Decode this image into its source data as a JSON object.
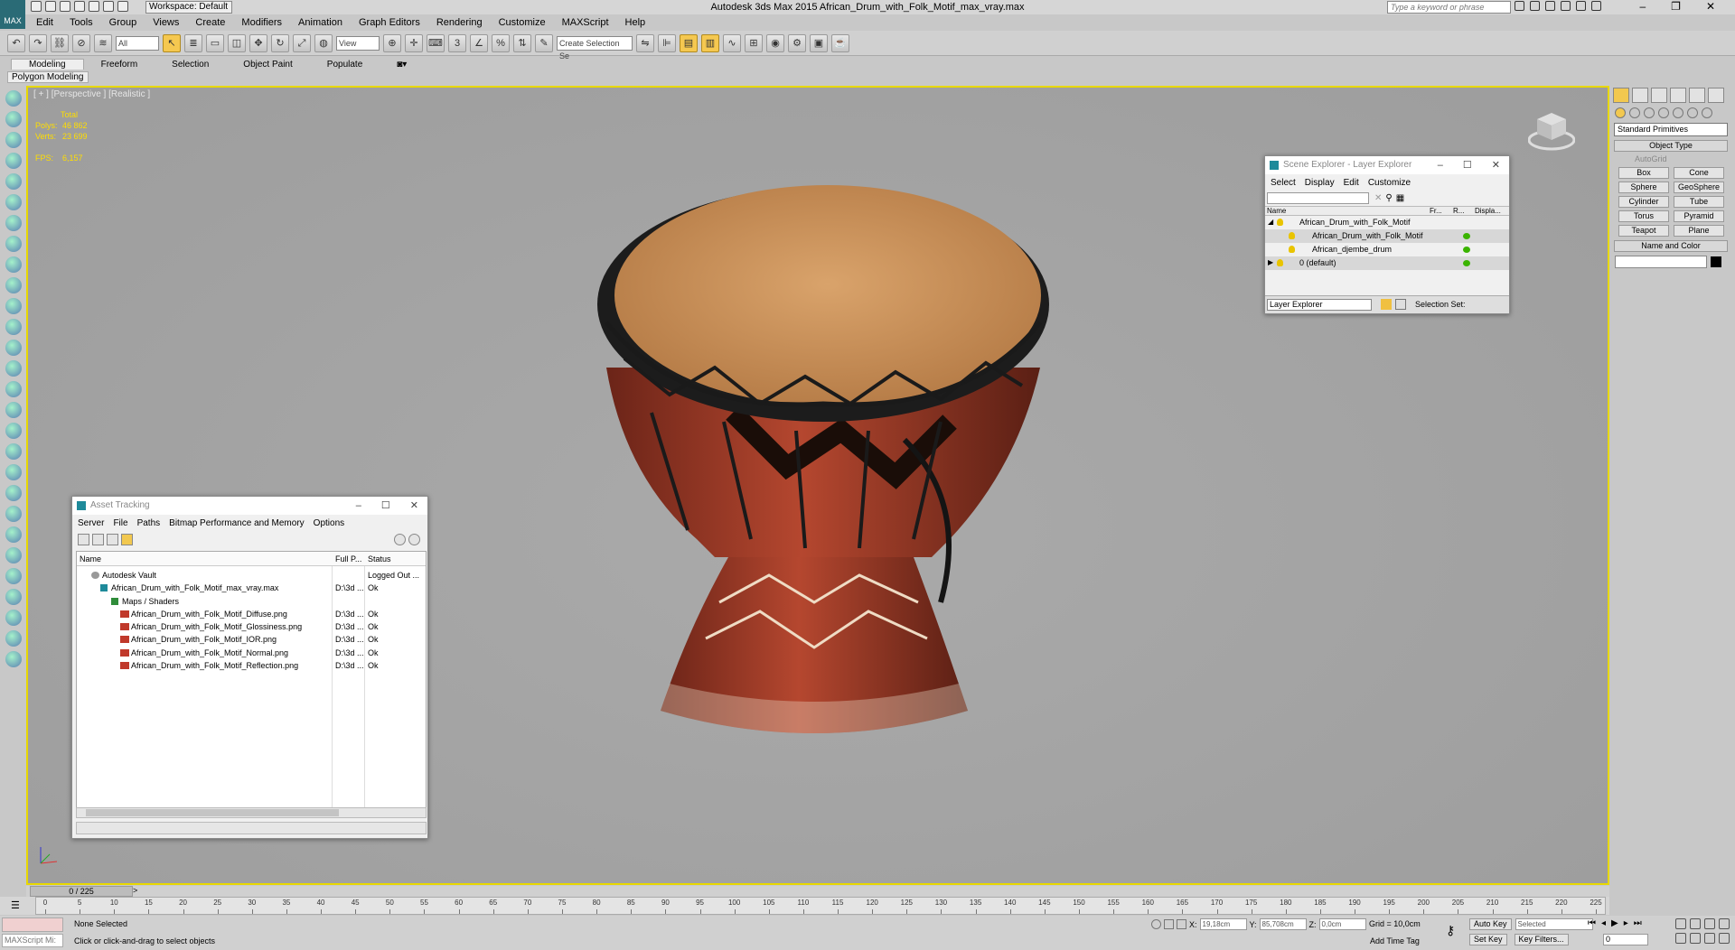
{
  "window": {
    "title": "Autodesk 3ds Max  2015     African_Drum_with_Folk_Motif_max_vray.max",
    "app_badge": "MAX"
  },
  "workspace": "Workspace: Default",
  "search_placeholder": "Type a keyword or phrase",
  "menu": [
    "Edit",
    "Tools",
    "Group",
    "Views",
    "Create",
    "Modifiers",
    "Animation",
    "Graph Editors",
    "Rendering",
    "Customize",
    "MAXScript",
    "Help"
  ],
  "toolbar": {
    "selection_filter": "All",
    "ref_coord": "View",
    "named_sel": "Create Selection Se"
  },
  "ribbon": {
    "tabs": [
      "Modeling",
      "Freeform",
      "Selection",
      "Object Paint",
      "Populate"
    ],
    "panel": "Polygon Modeling"
  },
  "viewport": {
    "label": "[ + ] [Perspective ] [Realistic ]",
    "stats": {
      "total": "Total",
      "polys_label": "Polys:",
      "polys": "46 862",
      "verts_label": "Verts:",
      "verts": "23 699",
      "fps_label": "FPS:",
      "fps": "6,157"
    }
  },
  "command_panel": {
    "dropdown": "Standard Primitives",
    "object_type": "Object Type",
    "autogrid": "AutoGrid",
    "buttons": [
      "Box",
      "Cone",
      "Sphere",
      "GeoSphere",
      "Cylinder",
      "Tube",
      "Torus",
      "Pyramid",
      "Teapot",
      "Plane"
    ],
    "name_and_color": "Name and Color",
    "object_color": "#000000"
  },
  "scene_explorer": {
    "title": "Scene Explorer - Layer Explorer",
    "menu": [
      "Select",
      "Display",
      "Edit",
      "Customize"
    ],
    "columns": [
      "Name",
      "Fr...",
      "R...",
      "Displa..."
    ],
    "rows": [
      {
        "name": "African_Drum_with_Folk_Motif"
      },
      {
        "name": "African_Drum_with_Folk_Motif"
      },
      {
        "name": "African_djembe_drum"
      },
      {
        "name": "0 (default)"
      }
    ],
    "footer_dropdown": "Layer Explorer",
    "footer_label": "Selection Set:"
  },
  "asset_tracking": {
    "title": "Asset Tracking",
    "menu": [
      "Server",
      "File",
      "Paths",
      "Bitmap Performance and Memory",
      "Options"
    ],
    "columns": [
      "Name",
      "Full P...",
      "Status"
    ],
    "rows": [
      {
        "name": "Autodesk Vault",
        "path": "",
        "status": "Logged Out ..."
      },
      {
        "name": "African_Drum_with_Folk_Motif_max_vray.max",
        "path": "D:\\3d ...",
        "status": "Ok"
      },
      {
        "name": "Maps / Shaders",
        "path": "",
        "status": ""
      },
      {
        "name": "African_Drum_with_Folk_Motif_Diffuse.png",
        "path": "D:\\3d ...",
        "status": "Ok"
      },
      {
        "name": "African_Drum_with_Folk_Motif_Glossiness.png",
        "path": "D:\\3d ...",
        "status": "Ok"
      },
      {
        "name": "African_Drum_with_Folk_Motif_IOR.png",
        "path": "D:\\3d ...",
        "status": "Ok"
      },
      {
        "name": "African_Drum_with_Folk_Motif_Normal.png",
        "path": "D:\\3d ...",
        "status": "Ok"
      },
      {
        "name": "African_Drum_with_Folk_Motif_Reflection.png",
        "path": "D:\\3d ...",
        "status": "Ok"
      }
    ]
  },
  "timeline": {
    "frame_counter": "0 / 225",
    "ticks": [
      0,
      5,
      10,
      15,
      20,
      25,
      30,
      35,
      40,
      45,
      50,
      55,
      60,
      65,
      70,
      75,
      80,
      85,
      90,
      95,
      100,
      105,
      110,
      115,
      120,
      125,
      130,
      135,
      140,
      145,
      150,
      155,
      160,
      165,
      170,
      175,
      180,
      185,
      190,
      195,
      200,
      205,
      210,
      215,
      220,
      225
    ]
  },
  "status": {
    "maxscript": "MAXScript Mi:",
    "selection": "None Selected",
    "hint": "Click or click-and-drag to select objects",
    "x_label": "X:",
    "x": "19,18cm",
    "y_label": "Y:",
    "y": "85,708cm",
    "z_label": "Z:",
    "z": "0,0cm",
    "grid": "Grid = 10,0cm",
    "add_time_tag": "Add Time Tag",
    "auto_key": "Auto Key",
    "selected": "Selected",
    "set_key": "Set Key",
    "key_filters": "Key Filters...",
    "frame": "0"
  }
}
